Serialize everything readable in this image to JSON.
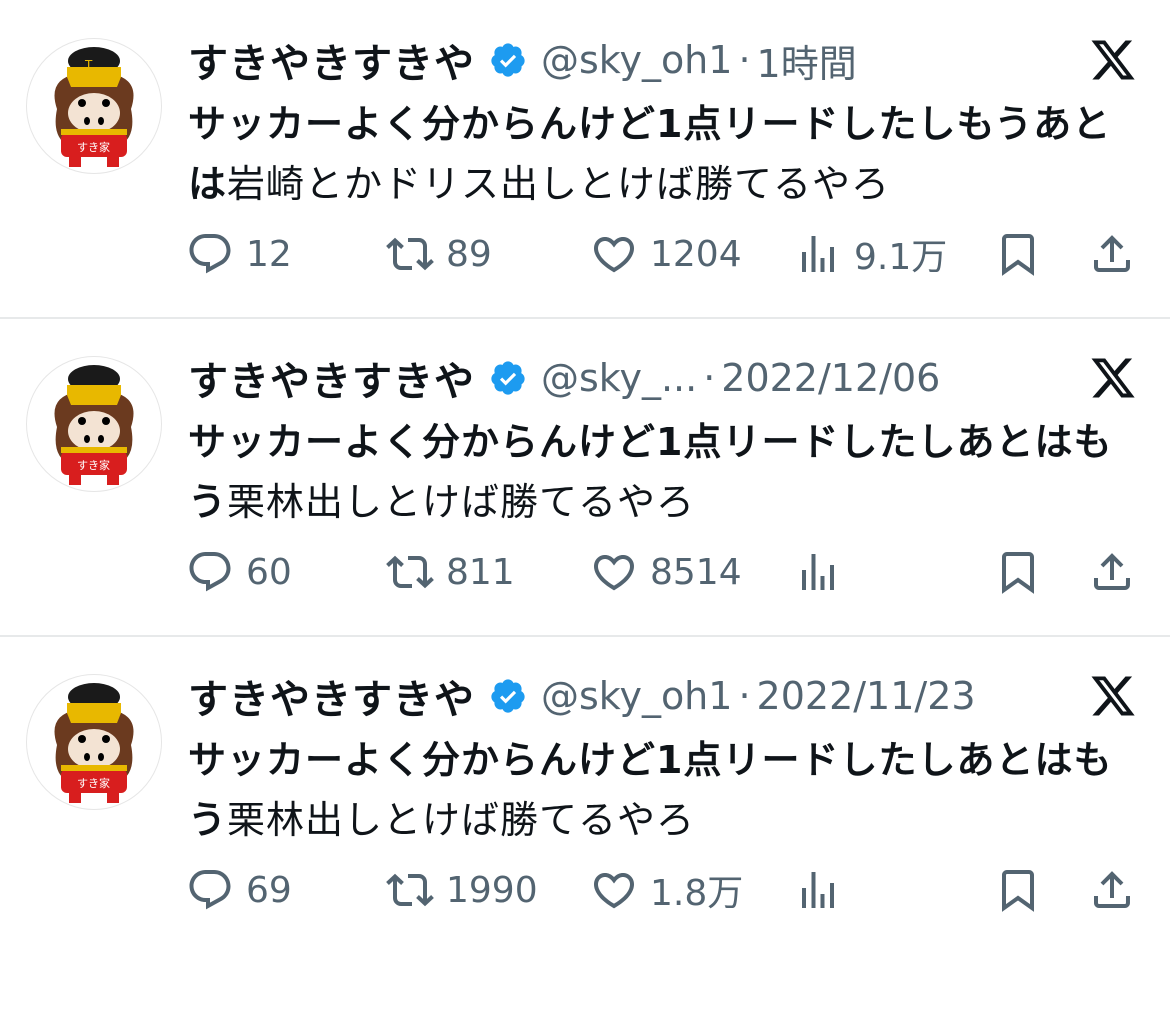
{
  "tweets": [
    {
      "name": "すきやきすきや",
      "handle": "@sky_oh1",
      "dot": "·",
      "time": "1時間",
      "text_bold": "サッカーよく分からんけど1点リードしたしもうあとは",
      "text_regular": "岩崎とかドリス出しとけば勝てるやろ",
      "replies": "12",
      "retweets": "89",
      "likes": "1204",
      "views": "9.1万"
    },
    {
      "name": "すきやきすきや",
      "handle": "@sky_...",
      "dot": "·",
      "time": "2022/12/06",
      "text_bold": "サッカーよく分からんけど1点リードしたしあとはもう",
      "text_regular": "栗林出しとけば勝てるやろ",
      "replies": "60",
      "retweets": "811",
      "likes": "8514",
      "views": ""
    },
    {
      "name": "すきやきすきや",
      "handle": "@sky_oh1",
      "dot": "·",
      "time": "2022/11/23",
      "text_bold": "サッカーよく分からんけど1点リードしたしあとはもう",
      "text_regular": "栗林出しとけば勝てるやろ",
      "replies": "69",
      "retweets": "1990",
      "likes": "1.8万",
      "views": ""
    }
  ],
  "avatar": {
    "logo_text": "すき家"
  },
  "colors": {
    "verified": "#1d9bf0",
    "muted": "#536471",
    "text": "#0f1419"
  },
  "icons": [
    "verified-badge-icon",
    "x-logo-icon",
    "reply-icon",
    "retweet-icon",
    "like-icon",
    "views-icon",
    "bookmark-icon",
    "share-icon"
  ]
}
